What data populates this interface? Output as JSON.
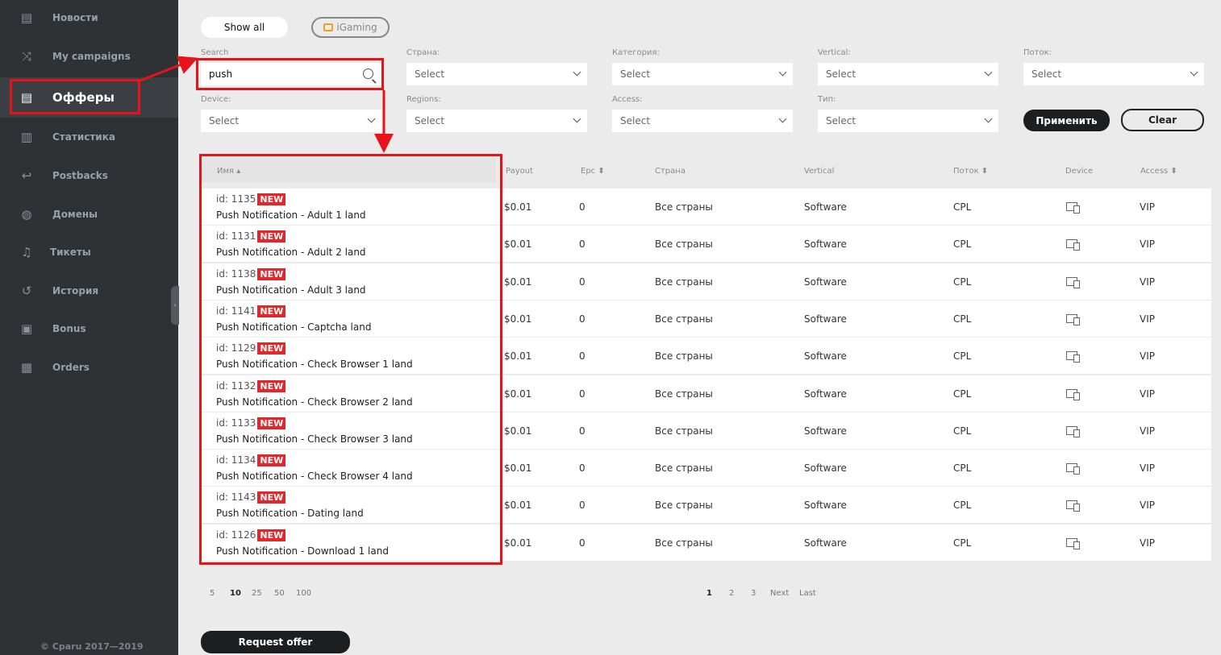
{
  "sidebar": {
    "items": [
      {
        "label": "Новости",
        "icon": "news-icon"
      },
      {
        "label": "My campaigns",
        "icon": "shuffle-icon"
      },
      {
        "label": "Офферы",
        "icon": "list-icon"
      },
      {
        "label": "Статистика",
        "icon": "chart-icon"
      },
      {
        "label": "Postbacks",
        "icon": "return-icon"
      },
      {
        "label": "Домены",
        "icon": "globe-icon"
      },
      {
        "label": "Тикеты",
        "icon": "bell-icon"
      },
      {
        "label": "История",
        "icon": "history-icon"
      },
      {
        "label": "Bonus",
        "icon": "gift-icon"
      },
      {
        "label": "Orders",
        "icon": "calendar-icon"
      }
    ],
    "copyright": "© Cparu 2017—2019"
  },
  "toolbar": {
    "show_all": "Show all",
    "igaming": "iGaming",
    "apply": "Применить",
    "clear": "Clear"
  },
  "filters": {
    "search_label": "Search",
    "search_value": "push",
    "country_label": "Страна:",
    "category_label": "Категория:",
    "vertical_label": "Vertical:",
    "flow_label": "Поток:",
    "device_label": "Device:",
    "regions_label": "Regions:",
    "access_label": "Access:",
    "type_label": "Тип:",
    "select_placeholder": "Select"
  },
  "table": {
    "headers": {
      "name": "Имя",
      "payout": "Payout",
      "epc": "Epc",
      "country": "Страна",
      "vertical": "Vertical",
      "flow": "Поток",
      "device": "Device",
      "access": "Access"
    },
    "new_badge": "NEW",
    "rows": [
      {
        "id": "id: 1135",
        "name": "Push Notification - Adult 1 land",
        "payout": "$0.01",
        "epc": "0",
        "country": "Все страны",
        "vertical": "Software",
        "flow": "CPL",
        "access": "VIP"
      },
      {
        "id": "id: 1131",
        "name": "Push Notification - Adult 2 land",
        "payout": "$0.01",
        "epc": "0",
        "country": "Все страны",
        "vertical": "Software",
        "flow": "CPL",
        "access": "VIP"
      },
      {
        "id": "id: 1138",
        "name": "Push Notification - Adult 3 land",
        "payout": "$0.01",
        "epc": "0",
        "country": "Все страны",
        "vertical": "Software",
        "flow": "CPL",
        "access": "VIP"
      },
      {
        "id": "id: 1141",
        "name": "Push Notification - Captcha land",
        "payout": "$0.01",
        "epc": "0",
        "country": "Все страны",
        "vertical": "Software",
        "flow": "CPL",
        "access": "VIP"
      },
      {
        "id": "id: 1129",
        "name": "Push Notification - Check Browser 1 land",
        "payout": "$0.01",
        "epc": "0",
        "country": "Все страны",
        "vertical": "Software",
        "flow": "CPL",
        "access": "VIP"
      },
      {
        "id": "id: 1132",
        "name": "Push Notification - Check Browser 2 land",
        "payout": "$0.01",
        "epc": "0",
        "country": "Все страны",
        "vertical": "Software",
        "flow": "CPL",
        "access": "VIP"
      },
      {
        "id": "id: 1133",
        "name": "Push Notification - Check Browser 3 land",
        "payout": "$0.01",
        "epc": "0",
        "country": "Все страны",
        "vertical": "Software",
        "flow": "CPL",
        "access": "VIP"
      },
      {
        "id": "id: 1134",
        "name": "Push Notification - Check Browser 4 land",
        "payout": "$0.01",
        "epc": "0",
        "country": "Все страны",
        "vertical": "Software",
        "flow": "CPL",
        "access": "VIP"
      },
      {
        "id": "id: 1143",
        "name": "Push Notification - Dating land",
        "payout": "$0.01",
        "epc": "0",
        "country": "Все страны",
        "vertical": "Software",
        "flow": "CPL",
        "access": "VIP"
      },
      {
        "id": "id: 1126",
        "name": "Push Notification - Download 1 land",
        "payout": "$0.01",
        "epc": "0",
        "country": "Все страны",
        "vertical": "Software",
        "flow": "CPL",
        "access": "VIP"
      }
    ]
  },
  "page_size": {
    "options": [
      "5",
      "10",
      "25",
      "50",
      "100"
    ],
    "selected": "10"
  },
  "pagination": {
    "pages": [
      "1",
      "2",
      "3"
    ],
    "next": "Next",
    "last": "Last",
    "current": "1"
  },
  "request_offer": "Request offer",
  "colors": {
    "sidebar": "#2f3235",
    "annotation": "#e8121b",
    "badge": "#e3262a",
    "accent": "#f0a21c"
  }
}
